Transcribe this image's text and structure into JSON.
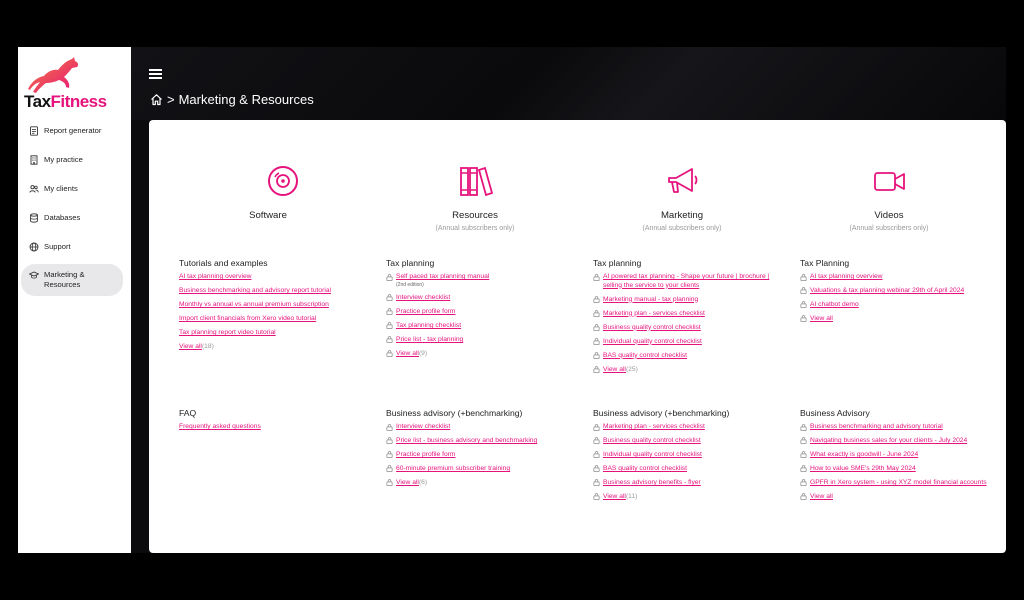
{
  "brand": {
    "name_part1": "Tax",
    "name_part2": "Fitness",
    "accent": "#e6137d"
  },
  "sidebar": {
    "items": [
      {
        "label": "Report generator",
        "icon": "report-icon"
      },
      {
        "label": "My practice",
        "icon": "building-icon"
      },
      {
        "label": "My clients",
        "icon": "users-icon"
      },
      {
        "label": "Databases",
        "icon": "database-icon"
      },
      {
        "label": "Support",
        "icon": "globe-icon"
      },
      {
        "label": "Marketing & Resources",
        "icon": "graduation-cap-icon",
        "active": true
      }
    ]
  },
  "header": {
    "breadcrumb": "Marketing & Resources",
    "separator": ">"
  },
  "columns": [
    {
      "title": "Software",
      "subtitle": "",
      "icon": "disc-icon",
      "sections": [
        {
          "title": "Tutorials and examples",
          "locked": false,
          "links": [
            "AI tax planning overview",
            "Business benchmarking and advisory report tutorial",
            "Monthly vs annual vs annual premium subscription",
            "Import client financials from Xero video tutorial",
            "Tax planning report video tutorial"
          ],
          "view_all": "View all",
          "count": "(18)"
        },
        {
          "title": "FAQ",
          "locked": false,
          "links": [
            "Frequently asked questions"
          ],
          "view_all": "",
          "count": ""
        }
      ]
    },
    {
      "title": "Resources",
      "subtitle": "(Annual subscribers only)",
      "icon": "books-icon",
      "sections": [
        {
          "title": "Tax planning",
          "locked": true,
          "links": [
            "Self paced tax planning manual",
            "Interview checklist",
            "Practice profile form",
            "Tax planning checklist",
            "Price list - tax planning"
          ],
          "edition_note": "(2nd edition)",
          "view_all": "View all",
          "count": "(9)"
        },
        {
          "title": "Business advisory (+benchmarking)",
          "locked": true,
          "links": [
            "Interview checklist",
            "Price list - business advisory and benchmarking",
            "Practice profile form",
            "60-minute premium subscriber training"
          ],
          "view_all": "View all",
          "count": "(6)"
        }
      ]
    },
    {
      "title": "Marketing",
      "subtitle": "(Annual subscribers only)",
      "icon": "megaphone-icon",
      "sections": [
        {
          "title": "Tax planning",
          "locked": true,
          "links": [
            "AI powered tax planning - Shape your future | brochure | selling the service to your clients",
            "Marketing manual - tax planning",
            "Marketing plan - services checklist",
            "Business quality control checklist",
            "Individual quality control checklist",
            "BAS quality control checklist"
          ],
          "view_all": "View all",
          "count": "(25)"
        },
        {
          "title": "Business advisory (+benchmarking)",
          "locked": true,
          "links": [
            "Marketing plan - services checklist",
            "Business quality control checklist",
            "Individual quality control checklist",
            "BAS quality control checklist",
            "Business advisory benefits - flyer"
          ],
          "view_all": "View all",
          "count": "(11)"
        }
      ]
    },
    {
      "title": "Videos",
      "subtitle": "(Annual subscribers only)",
      "icon": "video-camera-icon",
      "sections": [
        {
          "title": "Tax Planning",
          "locked": true,
          "links": [
            "AI tax planning overview",
            "Valuations & tax planning webinar  29th of April 2024",
            "AI chatbot demo"
          ],
          "view_all": "View all",
          "count": ""
        },
        {
          "title": "Business Advisory",
          "locked": true,
          "links": [
            "Business benchmarking and advisory tutorial",
            "Navigating business sales for your clients - July 2024",
            "What exactly is goodwill - June 2024",
            "How to value SME's 29th May 2024",
            "GPFR in Xero system - using XYZ model financial accounts"
          ],
          "view_all": "View all",
          "count": ""
        }
      ]
    }
  ]
}
